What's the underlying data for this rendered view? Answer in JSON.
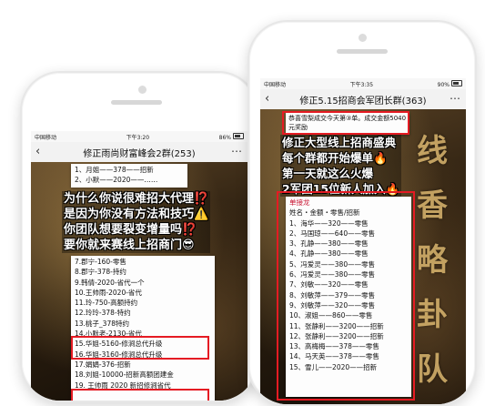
{
  "left_phone": {
    "status": {
      "carrier": "中国移动",
      "time": "下午3:20",
      "battery": "86%"
    },
    "title": "修正雨尚财富峰会2群(253)",
    "list_top": [
      "1、月姐——378——招新",
      "2、小默——2020——……"
    ],
    "overlay_lines": [
      "为什么你说很难招大代理⁉️",
      "是因为你没有方法和技巧⚠️",
      "你团队想要裂变增量吗⁉️",
      "要你就来赛线上招商门😎"
    ],
    "list_bottom": [
      "7.郡宁-160-零售",
      "8.郡宁-378-持约",
      "9.韩倩-2020-省代一个",
      "10.王帅雨-2020-省代",
      "11.玲-750-高额持约",
      "12.玲玲-378-特约",
      "13.桃子_378特约",
      "14.小默老-2130-省代",
      "15.华姐-5160-修涧总代升级",
      "16.华姐-3160-修涧总代升级",
      "17.娟娟-376-招新",
      "18.刘姐-10000-招新高额团建金",
      "19. 王帅雨 2020 新招修涧省代"
    ]
  },
  "right_phone": {
    "status": {
      "carrier": "中国移动",
      "time": "下午3:35",
      "battery": "90%"
    },
    "title": "修正5.15招商会军团长群(363)",
    "top_message": "恭喜雪梨成交今天第③单。成交金额5040元奖励",
    "overlay_lines": [
      "修正大型线上招商盛典",
      "每个群都开始爆单🔥",
      "第一天就这么火爆",
      "2军团15位新人加入🔥"
    ],
    "list_intro": "单接龙",
    "list_header": "姓名・金额・零售/招新",
    "list": [
      "1、海华——320——零售",
      "2、马国琼——640——零售",
      "3、孔静——380——零售",
      "4、孔静——380——零售",
      "5、冯爱灵——380——零售",
      "6、冯爱灵——380——零售",
      "7、刘敏——320——零售",
      "8、刘敏萍——379——零售",
      "9、刘敏萍——320——零售",
      "10、淑姐——860——零售",
      "11、张静利——3200——招新",
      "12、张静利——3200——招新",
      "13、高梅梅——378——零售",
      "14、马天英——378——零售",
      "15、雪儿——2020——招新"
    ],
    "calligraphy": [
      "线",
      "香",
      "略",
      "卦",
      "队"
    ]
  }
}
